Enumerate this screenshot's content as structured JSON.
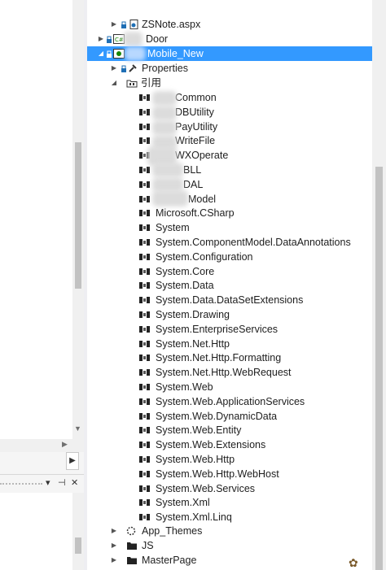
{
  "tree": {
    "rows": [
      {
        "label": "ZSNote.aspx",
        "expander": "right"
      },
      {
        "label": "Door",
        "expander": "right"
      },
      {
        "label": "Mobile_New",
        "expander": "down",
        "selected": true
      },
      {
        "label": "Properties",
        "expander": "right"
      },
      {
        "label": "引用",
        "expander": "down"
      }
    ],
    "references": [
      "Common",
      "DBUtility",
      "PayUtility",
      "WriteFile",
      "WXOperate",
      "BLL",
      "DAL",
      "Model",
      "Microsoft.CSharp",
      "System",
      "System.ComponentModel.DataAnnotations",
      "System.Configuration",
      "System.Core",
      "System.Data",
      "System.Data.DataSetExtensions",
      "System.Drawing",
      "System.EnterpriseServices",
      "System.Net.Http",
      "System.Net.Http.Formatting",
      "System.Net.Http.WebRequest",
      "System.Web",
      "System.Web.ApplicationServices",
      "System.Web.DynamicData",
      "System.Web.Entity",
      "System.Web.Extensions",
      "System.Web.Http",
      "System.Web.Http.WebHost",
      "System.Web.Services",
      "System.Xml",
      "System.Xml.Linq"
    ],
    "folders": [
      {
        "label": "App_Themes"
      },
      {
        "label": "JS"
      },
      {
        "label": "MasterPage"
      }
    ]
  },
  "left_toolbar": {
    "dropdown_glyph": "▾",
    "pin_glyph": "⊣",
    "close_glyph": "✕",
    "expand_glyph": "▶"
  },
  "colors": {
    "selection": "#3399ff",
    "project_icon": "#68217a",
    "csharp_icon": "#178600"
  }
}
